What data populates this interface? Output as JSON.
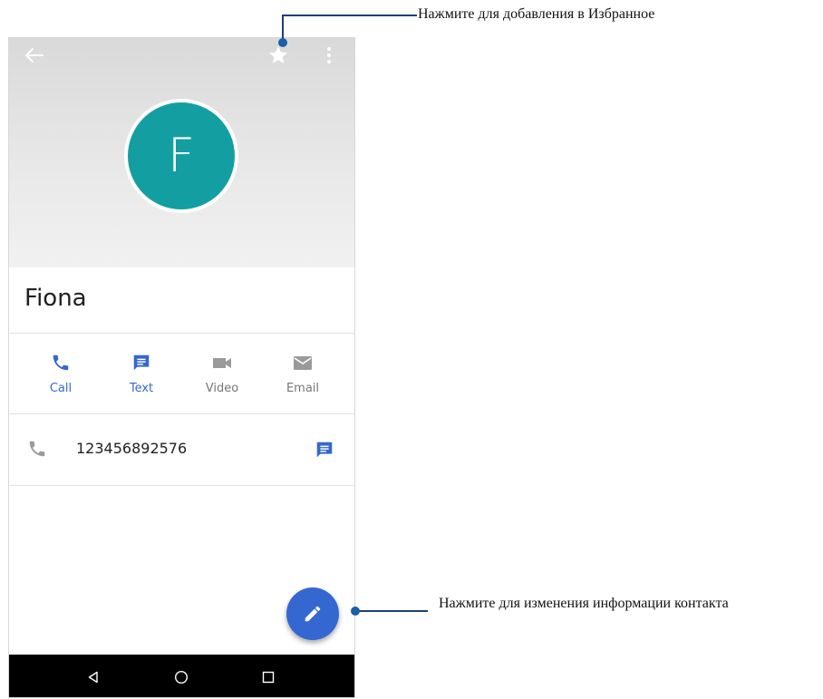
{
  "contact": {
    "initial": "F",
    "name": "Fiona",
    "phone_number": "123456892576",
    "avatar_color": "#139fa2"
  },
  "actions": [
    {
      "label": "Call",
      "icon": "phone-icon",
      "color": "#3567d1"
    },
    {
      "label": "Text",
      "icon": "message-icon",
      "color": "#3567d1"
    },
    {
      "label": "Video",
      "icon": "video-icon",
      "color": "#8a8a8a"
    },
    {
      "label": "Email",
      "icon": "email-icon",
      "color": "#8a8a8a"
    }
  ],
  "toolbar": {
    "back_icon": "arrow-back-icon",
    "favorite_icon": "star-icon",
    "menu_icon": "more-vert-icon"
  },
  "fab": {
    "icon": "pencil-icon",
    "color": "#3567d1"
  },
  "navbar": {
    "icons": [
      "back-triangle-icon",
      "home-circle-icon",
      "recents-square-icon"
    ]
  },
  "callouts": {
    "favorite": "Нажмите для добавления в Избранное",
    "edit": "Нажмите для изменения информации контакта"
  },
  "colors": {
    "accent": "#3567d1",
    "callout": "#1b3f7a"
  }
}
